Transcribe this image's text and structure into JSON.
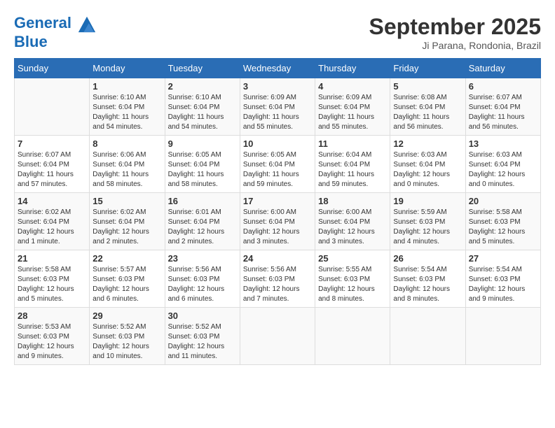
{
  "header": {
    "logo_line1": "General",
    "logo_line2": "Blue",
    "month": "September 2025",
    "location": "Ji Parana, Rondonia, Brazil"
  },
  "days_of_week": [
    "Sunday",
    "Monday",
    "Tuesday",
    "Wednesday",
    "Thursday",
    "Friday",
    "Saturday"
  ],
  "weeks": [
    [
      {
        "num": "",
        "info": ""
      },
      {
        "num": "1",
        "info": "Sunrise: 6:10 AM\nSunset: 6:04 PM\nDaylight: 11 hours\nand 54 minutes."
      },
      {
        "num": "2",
        "info": "Sunrise: 6:10 AM\nSunset: 6:04 PM\nDaylight: 11 hours\nand 54 minutes."
      },
      {
        "num": "3",
        "info": "Sunrise: 6:09 AM\nSunset: 6:04 PM\nDaylight: 11 hours\nand 55 minutes."
      },
      {
        "num": "4",
        "info": "Sunrise: 6:09 AM\nSunset: 6:04 PM\nDaylight: 11 hours\nand 55 minutes."
      },
      {
        "num": "5",
        "info": "Sunrise: 6:08 AM\nSunset: 6:04 PM\nDaylight: 11 hours\nand 56 minutes."
      },
      {
        "num": "6",
        "info": "Sunrise: 6:07 AM\nSunset: 6:04 PM\nDaylight: 11 hours\nand 56 minutes."
      }
    ],
    [
      {
        "num": "7",
        "info": "Sunrise: 6:07 AM\nSunset: 6:04 PM\nDaylight: 11 hours\nand 57 minutes."
      },
      {
        "num": "8",
        "info": "Sunrise: 6:06 AM\nSunset: 6:04 PM\nDaylight: 11 hours\nand 58 minutes."
      },
      {
        "num": "9",
        "info": "Sunrise: 6:05 AM\nSunset: 6:04 PM\nDaylight: 11 hours\nand 58 minutes."
      },
      {
        "num": "10",
        "info": "Sunrise: 6:05 AM\nSunset: 6:04 PM\nDaylight: 11 hours\nand 59 minutes."
      },
      {
        "num": "11",
        "info": "Sunrise: 6:04 AM\nSunset: 6:04 PM\nDaylight: 11 hours\nand 59 minutes."
      },
      {
        "num": "12",
        "info": "Sunrise: 6:03 AM\nSunset: 6:04 PM\nDaylight: 12 hours\nand 0 minutes."
      },
      {
        "num": "13",
        "info": "Sunrise: 6:03 AM\nSunset: 6:04 PM\nDaylight: 12 hours\nand 0 minutes."
      }
    ],
    [
      {
        "num": "14",
        "info": "Sunrise: 6:02 AM\nSunset: 6:04 PM\nDaylight: 12 hours\nand 1 minute."
      },
      {
        "num": "15",
        "info": "Sunrise: 6:02 AM\nSunset: 6:04 PM\nDaylight: 12 hours\nand 2 minutes."
      },
      {
        "num": "16",
        "info": "Sunrise: 6:01 AM\nSunset: 6:04 PM\nDaylight: 12 hours\nand 2 minutes."
      },
      {
        "num": "17",
        "info": "Sunrise: 6:00 AM\nSunset: 6:04 PM\nDaylight: 12 hours\nand 3 minutes."
      },
      {
        "num": "18",
        "info": "Sunrise: 6:00 AM\nSunset: 6:04 PM\nDaylight: 12 hours\nand 3 minutes."
      },
      {
        "num": "19",
        "info": "Sunrise: 5:59 AM\nSunset: 6:03 PM\nDaylight: 12 hours\nand 4 minutes."
      },
      {
        "num": "20",
        "info": "Sunrise: 5:58 AM\nSunset: 6:03 PM\nDaylight: 12 hours\nand 5 minutes."
      }
    ],
    [
      {
        "num": "21",
        "info": "Sunrise: 5:58 AM\nSunset: 6:03 PM\nDaylight: 12 hours\nand 5 minutes."
      },
      {
        "num": "22",
        "info": "Sunrise: 5:57 AM\nSunset: 6:03 PM\nDaylight: 12 hours\nand 6 minutes."
      },
      {
        "num": "23",
        "info": "Sunrise: 5:56 AM\nSunset: 6:03 PM\nDaylight: 12 hours\nand 6 minutes."
      },
      {
        "num": "24",
        "info": "Sunrise: 5:56 AM\nSunset: 6:03 PM\nDaylight: 12 hours\nand 7 minutes."
      },
      {
        "num": "25",
        "info": "Sunrise: 5:55 AM\nSunset: 6:03 PM\nDaylight: 12 hours\nand 8 minutes."
      },
      {
        "num": "26",
        "info": "Sunrise: 5:54 AM\nSunset: 6:03 PM\nDaylight: 12 hours\nand 8 minutes."
      },
      {
        "num": "27",
        "info": "Sunrise: 5:54 AM\nSunset: 6:03 PM\nDaylight: 12 hours\nand 9 minutes."
      }
    ],
    [
      {
        "num": "28",
        "info": "Sunrise: 5:53 AM\nSunset: 6:03 PM\nDaylight: 12 hours\nand 9 minutes."
      },
      {
        "num": "29",
        "info": "Sunrise: 5:52 AM\nSunset: 6:03 PM\nDaylight: 12 hours\nand 10 minutes."
      },
      {
        "num": "30",
        "info": "Sunrise: 5:52 AM\nSunset: 6:03 PM\nDaylight: 12 hours\nand 11 minutes."
      },
      {
        "num": "",
        "info": ""
      },
      {
        "num": "",
        "info": ""
      },
      {
        "num": "",
        "info": ""
      },
      {
        "num": "",
        "info": ""
      }
    ]
  ]
}
